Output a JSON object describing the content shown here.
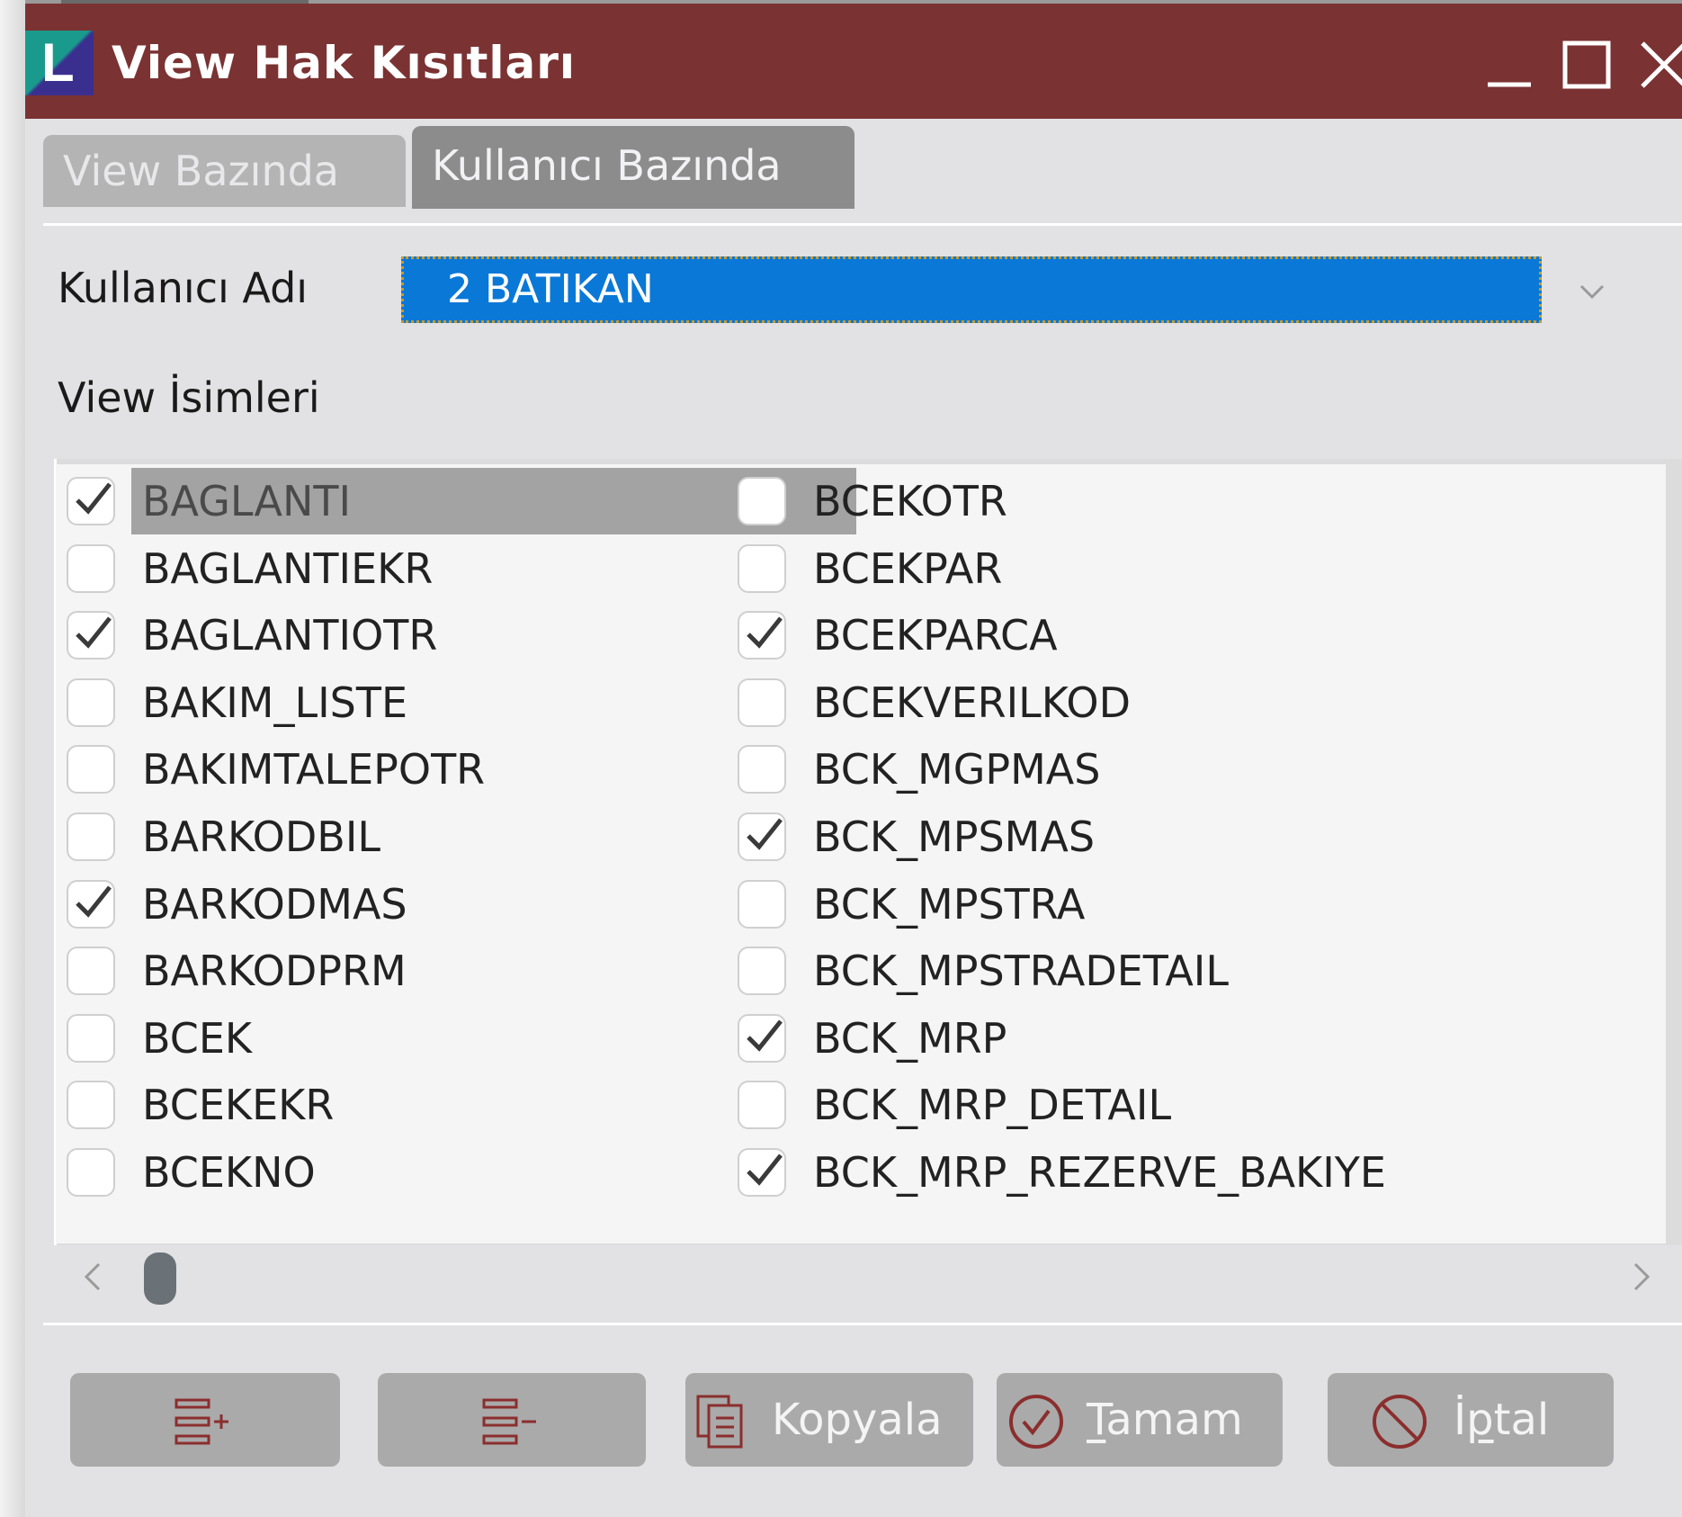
{
  "window": {
    "title": "View Hak Kısıtları",
    "logo_letter": "L",
    "controls": [
      "minimize-icon",
      "maximize-icon",
      "close-icon"
    ]
  },
  "tabs": [
    {
      "label": "View Bazında",
      "active": false
    },
    {
      "label": "Kullanıcı Bazında",
      "active": true
    }
  ],
  "user_section": {
    "label": "Kullanıcı Adı",
    "selected_user": "2 BATIKAN"
  },
  "view_list": {
    "heading": "View İsimleri",
    "columns": [
      [
        {
          "name": "BAGLANTI",
          "checked": true,
          "selected": true
        },
        {
          "name": "BAGLANTIEKR",
          "checked": false
        },
        {
          "name": "BAGLANTIOTR",
          "checked": true
        },
        {
          "name": "BAKIM_LISTE",
          "checked": false
        },
        {
          "name": "BAKIMTALEPOTR",
          "checked": false
        },
        {
          "name": "BARKODBIL",
          "checked": false
        },
        {
          "name": "BARKODMAS",
          "checked": true
        },
        {
          "name": "BARKODPRM",
          "checked": false
        },
        {
          "name": "BCEK",
          "checked": false
        },
        {
          "name": "BCEKEKR",
          "checked": false
        },
        {
          "name": "BCEKNO",
          "checked": false
        }
      ],
      [
        {
          "name": "BCEKOTR",
          "checked": false
        },
        {
          "name": "BCEKPAR",
          "checked": false
        },
        {
          "name": "BCEKPARCA",
          "checked": true
        },
        {
          "name": "BCEKVERILKOD",
          "checked": false
        },
        {
          "name": "BCK_MGPMAS",
          "checked": false
        },
        {
          "name": "BCK_MPSMAS",
          "checked": true
        },
        {
          "name": "BCK_MPSTRA",
          "checked": false
        },
        {
          "name": "BCK_MPSTRADETAIL",
          "checked": false
        },
        {
          "name": "BCK_MRP",
          "checked": true
        },
        {
          "name": "BCK_MRP_DETAIL",
          "checked": false
        },
        {
          "name": "BCK_MRP_REZERVE_BAKIYE",
          "checked": true
        }
      ]
    ]
  },
  "buttons": {
    "add_rows_icon": "list-add-icon",
    "remove_rows_icon": "list-remove-icon",
    "copy": {
      "label": "Kopyala",
      "icon": "copy-icon"
    },
    "ok": {
      "label_pre": "",
      "mnemonic": "T",
      "label_post": "amam",
      "icon": "check-circle-icon"
    },
    "cancel": {
      "label_pre": "İ",
      "mnemonic": "p",
      "label_post": "tal",
      "icon": "no-entry-icon"
    }
  },
  "colors": {
    "titlebar": "#7b3232",
    "selection_blue": "#0a78d7",
    "button_gray": "#aaaaaa",
    "icon_red": "#8b2e2e"
  }
}
